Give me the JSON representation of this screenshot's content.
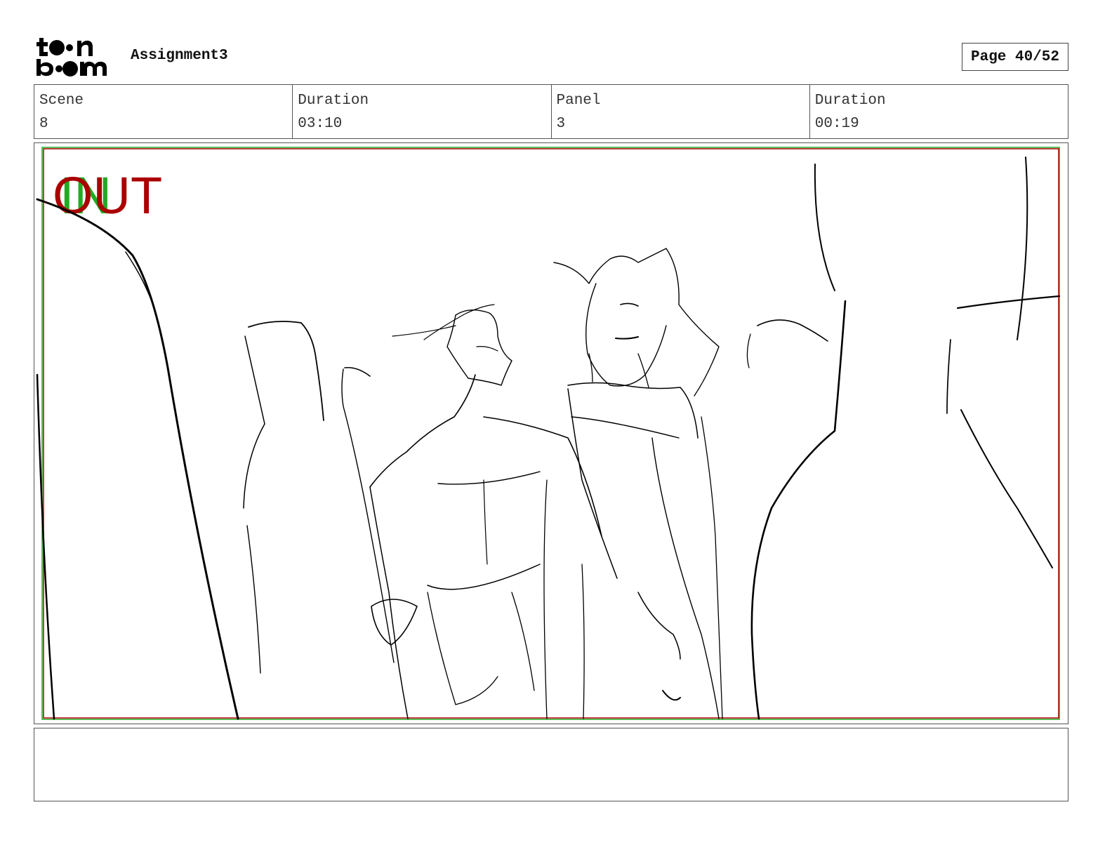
{
  "header": {
    "logo_label": "toon boom",
    "project_title": "Assignment3",
    "page_label": "Page 40/52"
  },
  "info": {
    "scene_label": "Scene",
    "scene_value": "8",
    "scene_duration_label": "Duration",
    "scene_duration_value": "03:10",
    "panel_label": "Panel",
    "panel_value": "3",
    "panel_duration_label": "Duration",
    "panel_duration_value": "00:19"
  },
  "panel": {
    "in_marker": "IN",
    "out_marker": "OUT",
    "in_color": "#22aa22",
    "out_color": "#aa0000"
  },
  "dialog": {
    "text": ""
  }
}
